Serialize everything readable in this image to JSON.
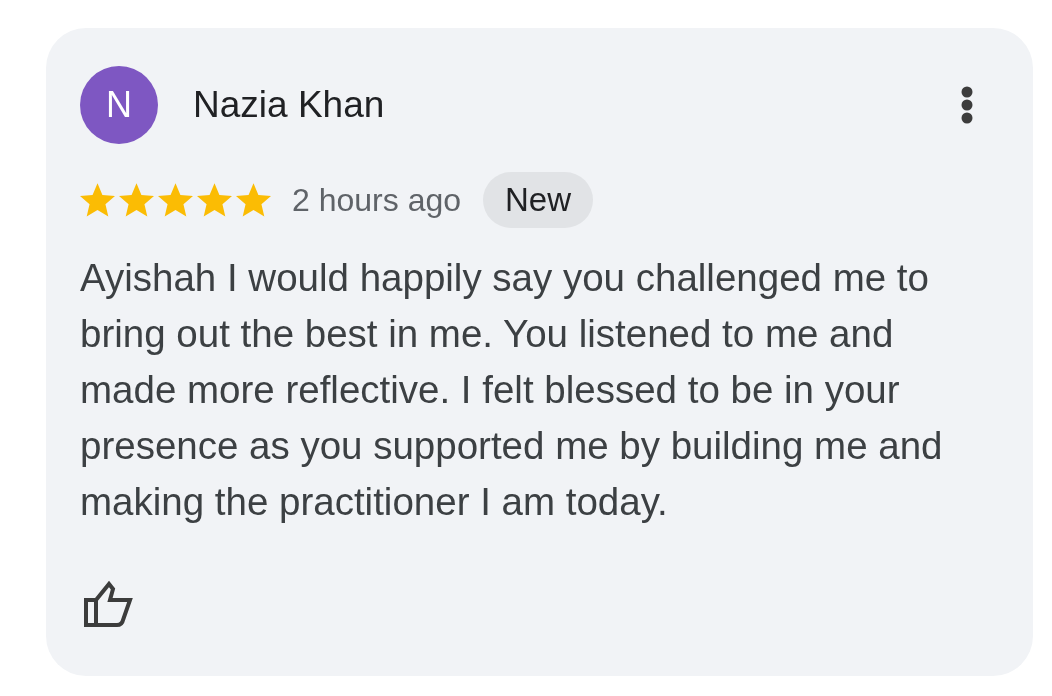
{
  "review": {
    "author": {
      "initial": "N",
      "name": "Nazia Khan"
    },
    "stars": 5,
    "time": "2 hours ago",
    "badge": "New",
    "text": "Ayishah I would happily say you challenged me to bring out the best in me. You listened to me and made more reflective. I felt blessed to be in your presence as you supported me by building me and making the practitioner I am today."
  }
}
